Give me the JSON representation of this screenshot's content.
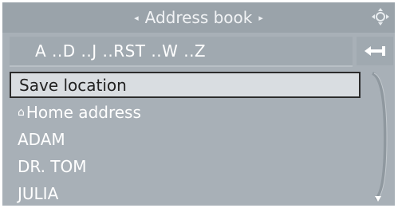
{
  "header": {
    "title": "Address book",
    "prev_arrow": "◂",
    "next_arrow": "▸"
  },
  "alphabet_bar": {
    "letters": "A ..D ..J ..RST ..W ..Z"
  },
  "list": {
    "items": [
      {
        "label": "Save location"
      },
      {
        "label": "Home address"
      },
      {
        "label": "ADAM"
      },
      {
        "label": "DR. TOM"
      },
      {
        "label": "JULIA"
      }
    ]
  },
  "icons": {
    "controller": "controller-knob-icon",
    "back": "back-arrow-icon",
    "home": "house-icon",
    "scroll_down": "chevron-down-icon"
  },
  "colors": {
    "background": "#a8b0b7",
    "highlight": "#d9dde1",
    "text": "#ffffff"
  }
}
